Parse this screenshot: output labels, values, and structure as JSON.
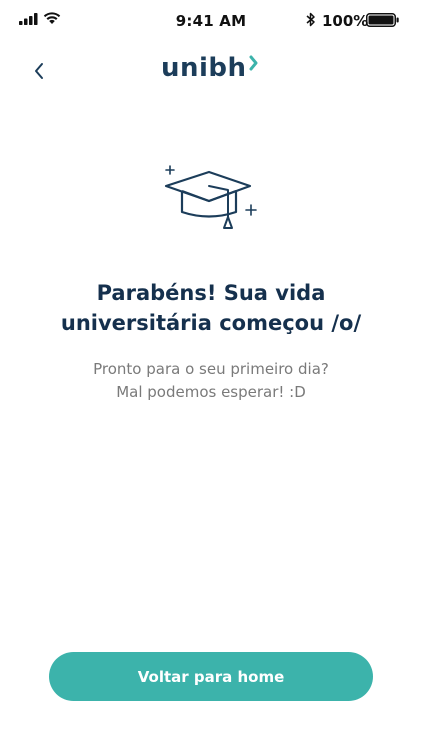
{
  "status_bar": {
    "time": "9:41 AM",
    "battery_percent": "100%",
    "icons": [
      "signal-icon",
      "wifi-icon",
      "bluetooth-icon",
      "battery-icon"
    ]
  },
  "header": {
    "back_icon": "chevron-left-icon",
    "logo_text": "unibh",
    "logo_color": "#1c3d5a",
    "logo_accent_color": "#3cb3ab"
  },
  "main": {
    "illustration_icon": "graduation-cap-icon",
    "title_line1": "Parabéns! Sua vida",
    "title_line2": "universitária começou /o/",
    "subtitle_line1": "Pronto para o seu primeiro dia?",
    "subtitle_line2": "Mal podemos esperar! :D"
  },
  "cta": {
    "label": "Voltar para home",
    "color": "#3cb3ab"
  }
}
